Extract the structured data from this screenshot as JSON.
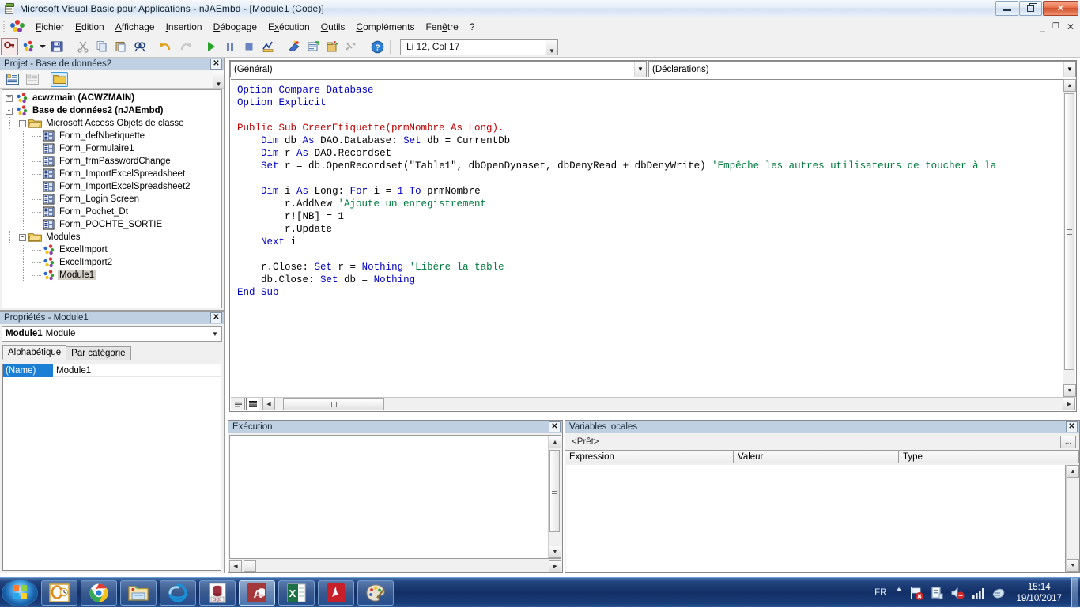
{
  "window": {
    "title": "Microsoft Visual Basic pour Applications - nJAEmbd - [Module1 (Code)]",
    "icon": "vba-document-icon",
    "minimize_label": "–",
    "maximize_label": "❐",
    "close_label": "✕",
    "mdi_minimize": "_",
    "mdi_restore": "❐",
    "mdi_close": "✕"
  },
  "menubar": {
    "items": [
      {
        "label": "Fichier",
        "accel": "F"
      },
      {
        "label": "Edition",
        "accel": "E"
      },
      {
        "label": "Affichage",
        "accel": "A"
      },
      {
        "label": "Insertion",
        "accel": "I"
      },
      {
        "label": "Débogage",
        "accel": "D"
      },
      {
        "label": "Exécution",
        "accel": "x"
      },
      {
        "label": "Outils",
        "accel": "O"
      },
      {
        "label": "Compléments",
        "accel": "C"
      },
      {
        "label": "Fenêtre",
        "accel": "ê"
      },
      {
        "label": "?",
        "accel": ""
      }
    ]
  },
  "toolbar": {
    "buttons": [
      "view-access-icon",
      "insert-module-icon",
      "insert-dropdown-icon",
      "save-icon",
      "cut-icon",
      "copy-icon",
      "paste-icon",
      "find-icon",
      "undo-icon",
      "redo-icon",
      "run-icon",
      "break-icon",
      "reset-icon",
      "design-mode-icon",
      "project-explorer-icon",
      "properties-window-icon",
      "object-browser-icon",
      "toolbox-icon",
      "help-icon"
    ],
    "position_indicator": "Li 12, Col 17"
  },
  "project_panel": {
    "title": "Projet - Base de données2",
    "close_label": "✕",
    "toolbar": [
      "view-code-icon",
      "view-object-icon",
      "toggle-folders-icon"
    ],
    "tree": [
      {
        "depth": 0,
        "toggle": "+",
        "icon": "project-icon",
        "label": "acwzmain (ACWZMAIN)",
        "bold": true,
        "selected": false
      },
      {
        "depth": 0,
        "toggle": "-",
        "icon": "project-icon",
        "label": "Base de données2 (nJAEmbd)",
        "bold": true,
        "selected": false
      },
      {
        "depth": 1,
        "toggle": "-",
        "icon": "folder-icon",
        "label": "Microsoft Access Objets de classe",
        "bold": false,
        "selected": false
      },
      {
        "depth": 2,
        "toggle": "",
        "icon": "form-icon",
        "label": "Form_defNbetiquette",
        "bold": false,
        "selected": false
      },
      {
        "depth": 2,
        "toggle": "",
        "icon": "form-icon",
        "label": "Form_Formulaire1",
        "bold": false,
        "selected": false
      },
      {
        "depth": 2,
        "toggle": "",
        "icon": "form-icon",
        "label": "Form_frmPasswordChange",
        "bold": false,
        "selected": false
      },
      {
        "depth": 2,
        "toggle": "",
        "icon": "form-icon",
        "label": "Form_ImportExcelSpreadsheet",
        "bold": false,
        "selected": false
      },
      {
        "depth": 2,
        "toggle": "",
        "icon": "form-icon",
        "label": "Form_ImportExcelSpreadsheet2",
        "bold": false,
        "selected": false
      },
      {
        "depth": 2,
        "toggle": "",
        "icon": "form-icon",
        "label": "Form_Login Screen",
        "bold": false,
        "selected": false
      },
      {
        "depth": 2,
        "toggle": "",
        "icon": "form-icon",
        "label": "Form_Pochet_Dt",
        "bold": false,
        "selected": false
      },
      {
        "depth": 2,
        "toggle": "",
        "icon": "form-icon",
        "label": "Form_POCHTE_SORTIE",
        "bold": false,
        "selected": false
      },
      {
        "depth": 1,
        "toggle": "-",
        "icon": "folder-icon",
        "label": "Modules",
        "bold": false,
        "selected": false
      },
      {
        "depth": 2,
        "toggle": "",
        "icon": "module-icon",
        "label": "ExcelImport",
        "bold": false,
        "selected": false
      },
      {
        "depth": 2,
        "toggle": "",
        "icon": "module-icon",
        "label": "ExcelImport2",
        "bold": false,
        "selected": false
      },
      {
        "depth": 2,
        "toggle": "",
        "icon": "module-icon",
        "label": "Module1",
        "bold": false,
        "selected": true
      }
    ]
  },
  "properties_panel": {
    "title": "Propriétés - Module1",
    "close_label": "✕",
    "object_name": "Module1",
    "object_type": "Module",
    "tabs": [
      {
        "label": "Alphabétique",
        "active": true
      },
      {
        "label": "Par catégorie",
        "active": false
      }
    ],
    "rows": [
      {
        "key": "(Name)",
        "value": "Module1"
      }
    ]
  },
  "code_window": {
    "object_combo": "(Général)",
    "procedure_combo": "(Déclarations)",
    "view_buttons": [
      "procedure-view-icon",
      "full-module-view-icon"
    ],
    "lines": [
      [
        {
          "t": "Option Compare Database",
          "c": "kw"
        }
      ],
      [
        {
          "t": "Option Explicit",
          "c": "kw"
        }
      ],
      [
        {
          "t": "",
          "c": "pl"
        }
      ],
      [
        {
          "t": "Public Sub CreerEtiquette(prmNombre As Long).",
          "c": "rd"
        }
      ],
      [
        {
          "t": "    ",
          "c": "pl"
        },
        {
          "t": "Dim",
          "c": "kw"
        },
        {
          "t": " db ",
          "c": "pl"
        },
        {
          "t": "As",
          "c": "kw"
        },
        {
          "t": " DAO.Database: ",
          "c": "pl"
        },
        {
          "t": "Set",
          "c": "kw"
        },
        {
          "t": " db = CurrentDb",
          "c": "pl"
        }
      ],
      [
        {
          "t": "    ",
          "c": "pl"
        },
        {
          "t": "Dim",
          "c": "kw"
        },
        {
          "t": " r ",
          "c": "pl"
        },
        {
          "t": "As",
          "c": "kw"
        },
        {
          "t": " DAO.Recordset",
          "c": "pl"
        }
      ],
      [
        {
          "t": "    ",
          "c": "pl"
        },
        {
          "t": "Set",
          "c": "kw"
        },
        {
          "t": " r = db.OpenRecordset(\"Table1\", dbOpenDynaset, dbDenyRead + dbDenyWrite) ",
          "c": "pl"
        },
        {
          "t": "'Empêche les autres utilisateurs de toucher à la",
          "c": "cm"
        }
      ],
      [
        {
          "t": "",
          "c": "pl"
        }
      ],
      [
        {
          "t": "    ",
          "c": "pl"
        },
        {
          "t": "Dim",
          "c": "kw"
        },
        {
          "t": " i ",
          "c": "pl"
        },
        {
          "t": "As",
          "c": "kw"
        },
        {
          "t": " Long: ",
          "c": "pl"
        },
        {
          "t": "For",
          "c": "kw"
        },
        {
          "t": " i = ",
          "c": "pl"
        },
        {
          "t": "1",
          "c": "kw"
        },
        {
          "t": " ",
          "c": "pl"
        },
        {
          "t": "To",
          "c": "kw"
        },
        {
          "t": " prmNombre",
          "c": "pl"
        }
      ],
      [
        {
          "t": "        r.AddNew ",
          "c": "pl"
        },
        {
          "t": "'Ajoute un enregistrement",
          "c": "cm"
        }
      ],
      [
        {
          "t": "        r![NB] = 1",
          "c": "pl"
        }
      ],
      [
        {
          "t": "        r.Update",
          "c": "pl"
        }
      ],
      [
        {
          "t": "    ",
          "c": "pl"
        },
        {
          "t": "Next",
          "c": "kw"
        },
        {
          "t": " i",
          "c": "pl"
        }
      ],
      [
        {
          "t": "",
          "c": "pl"
        }
      ],
      [
        {
          "t": "    r.Close: ",
          "c": "pl"
        },
        {
          "t": "Set",
          "c": "kw"
        },
        {
          "t": " r = ",
          "c": "pl"
        },
        {
          "t": "Nothing",
          "c": "kw"
        },
        {
          "t": " ",
          "c": "pl"
        },
        {
          "t": "'Libère la table",
          "c": "cm"
        }
      ],
      [
        {
          "t": "    db.Close: ",
          "c": "pl"
        },
        {
          "t": "Set",
          "c": "kw"
        },
        {
          "t": " db = ",
          "c": "pl"
        },
        {
          "t": "Nothing",
          "c": "kw"
        }
      ],
      [
        {
          "t": "",
          "c": "kw"
        },
        {
          "t": "End Sub",
          "c": "kw"
        }
      ]
    ]
  },
  "exec_panel": {
    "title": "Exécution",
    "close_label": "✕",
    "content": ""
  },
  "locals_panel": {
    "title": "Variables locales",
    "close_label": "✕",
    "status": "<Prêt>",
    "call_stack_button": "...",
    "columns": [
      "Expression",
      "Valeur",
      "Type"
    ],
    "rows": []
  },
  "taskbar": {
    "start_label": "start-orb",
    "items": [
      "outlook-icon",
      "chrome-icon",
      "file-explorer-icon",
      "internet-explorer-icon",
      "sql-server-icon",
      "access-icon",
      "excel-icon",
      "adobe-reader-icon",
      "paint-icon"
    ],
    "active_item_index": 5,
    "tray": {
      "language": "FR",
      "show_hidden": "▲",
      "icons": [
        "network-error-icon",
        "action-center-icon",
        "volume-muted-icon",
        "signal-icon",
        "flash-icon"
      ],
      "time": "15:14",
      "date": "19/10/2017"
    }
  },
  "colors": {
    "keyword_blue": "#0000c0",
    "declaration_red": "#c00000",
    "comment_green": "#007a3d",
    "panel_title_bg": "#bed0e2",
    "selection_blue": "#1a7fd4",
    "taskbar_blue": "#10356e"
  }
}
